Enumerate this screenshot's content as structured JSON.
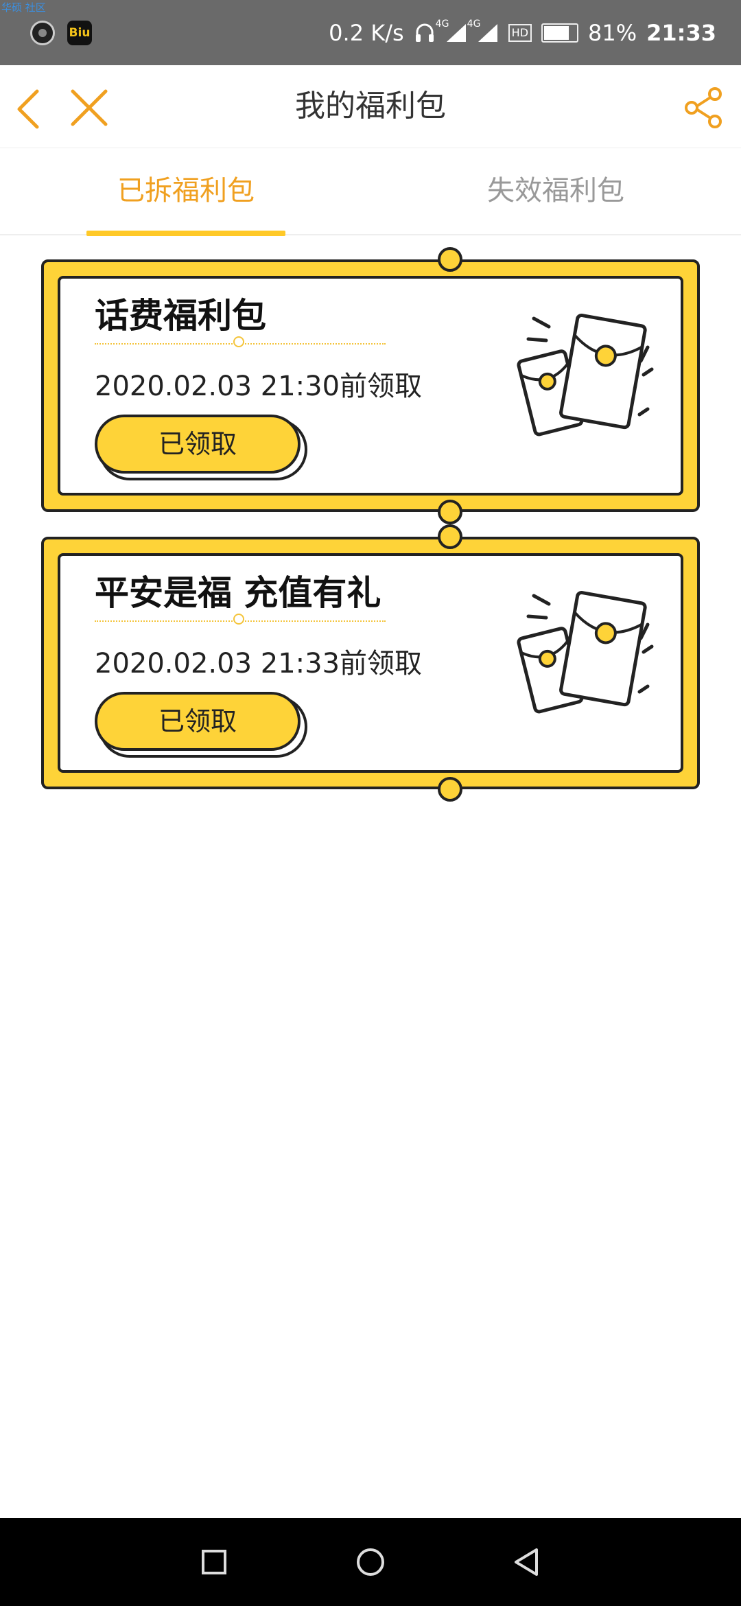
{
  "status_bar": {
    "overlay_text": "华硕 社区",
    "app_icon_biu": "Biu",
    "net_speed": "0.2 K/s",
    "net_type_1": "4G",
    "net_type_2": "4G",
    "hd_label": "HD",
    "battery_percent": "81%",
    "battery_level": 0.81,
    "time": "21:33"
  },
  "header": {
    "title": "我的福利包",
    "icons": {
      "back": "chevron-left-icon",
      "close": "close-icon",
      "share": "share-icon"
    }
  },
  "tabs": [
    {
      "label": "已拆福利包",
      "active": true
    },
    {
      "label": "失效福利包",
      "active": false
    }
  ],
  "cards": [
    {
      "title": "话费福利包",
      "deadline": "2020.02.03 21:30前领取",
      "button_label": "已领取"
    },
    {
      "title": "平安是福 充值有礼",
      "deadline": "2020.02.03 21:33前领取",
      "button_label": "已领取"
    }
  ],
  "colors": {
    "accent": "#f0a020",
    "card_yellow": "#fed338",
    "outline": "#222222"
  },
  "nav_bar": {
    "icons": [
      "square-recents-icon",
      "circle-home-icon",
      "triangle-back-icon"
    ]
  }
}
